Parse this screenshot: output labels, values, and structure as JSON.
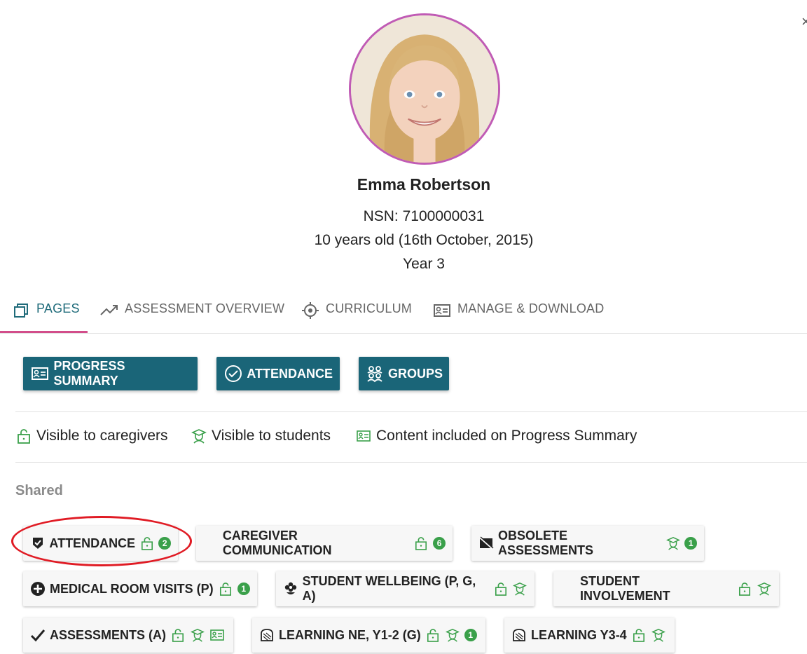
{
  "close_icon": "close-icon",
  "student": {
    "name": "Emma Robertson",
    "nsn": "NSN: 7100000031",
    "age": "10 years old (16th October, 2015)",
    "year": "Year 3"
  },
  "tabs": [
    {
      "label": "PAGES",
      "icon": "pages-icon",
      "active": true
    },
    {
      "label": "ASSESSMENT OVERVIEW",
      "icon": "trend-icon"
    },
    {
      "label": "CURRICULUM",
      "icon": "target-icon"
    },
    {
      "label": "MANAGE & DOWNLOAD",
      "icon": "id-card-icon"
    }
  ],
  "primary_buttons": [
    {
      "label": "PROGRESS SUMMARY",
      "icon": "id-card-icon"
    },
    {
      "label": "ATTENDANCE",
      "icon": "check-circle-icon"
    },
    {
      "label": "GROUPS",
      "icon": "groups-icon"
    }
  ],
  "legend": [
    {
      "label": "Visible to caregivers",
      "icon": "unlock-icon"
    },
    {
      "label": "Visible to students",
      "icon": "student-icon"
    },
    {
      "label": "Content included on Progress Summary",
      "icon": "id-card-icon"
    }
  ],
  "section": {
    "label": "Shared"
  },
  "chips": [
    {
      "label": "ATTENDANCE",
      "icon": "shield-check-icon",
      "count": "2"
    },
    {
      "label": "CAREGIVER COMMUNICATION",
      "count": "6"
    },
    {
      "label": "OBSOLETE ASSESSMENTS",
      "icon": "no-image-icon",
      "count": "1"
    },
    {
      "label": "MEDICAL ROOM VISITS (P)",
      "icon": "plus-circle-icon",
      "count": "1"
    },
    {
      "label": "STUDENT WELLBEING (P, G, A)",
      "icon": "flower-icon"
    },
    {
      "label": "STUDENT INVOLVEMENT"
    },
    {
      "label": "ASSESSMENTS (A)",
      "icon": "checkmark-icon"
    },
    {
      "label": "LEARNING NE, Y1-2 (G)",
      "icon": "bread-icon",
      "count": "1"
    },
    {
      "label": "LEARNING Y3-4",
      "icon": "bread-icon"
    }
  ],
  "colors": {
    "primary": "#1a6578",
    "accent": "#d24d8a",
    "green": "#3aa04a",
    "avatar_ring": "#c05bb5"
  }
}
